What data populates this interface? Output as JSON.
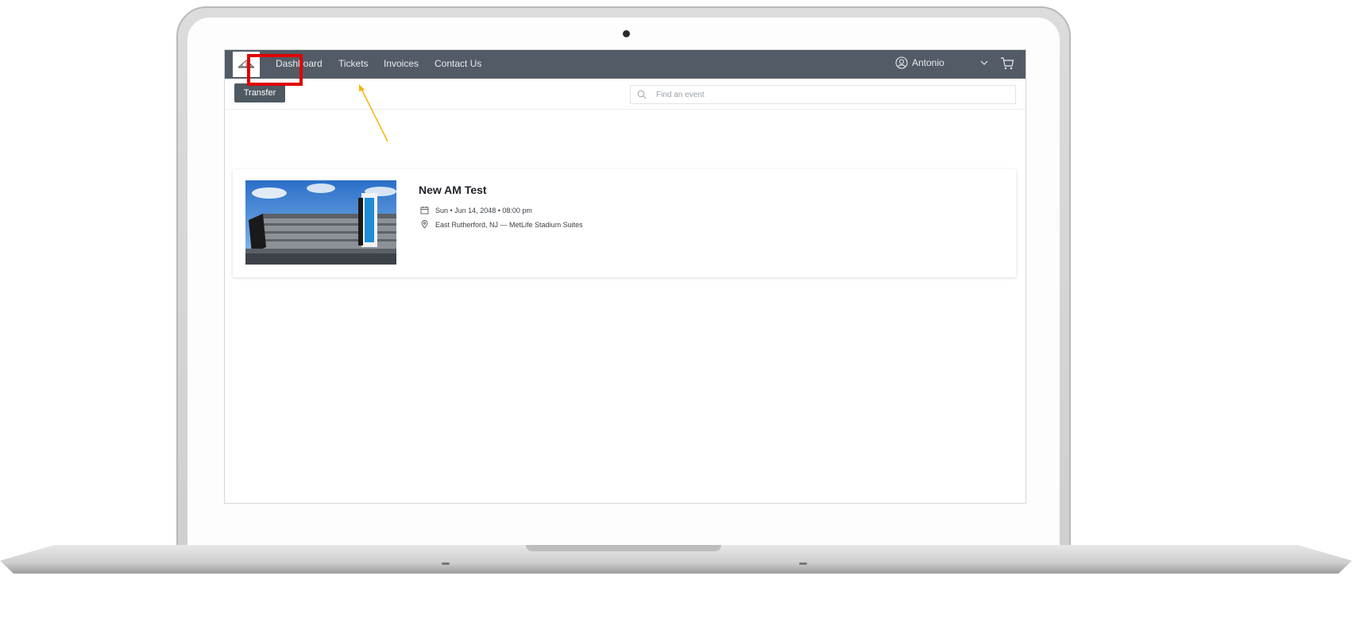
{
  "nav": {
    "items": [
      "Dashboard",
      "Tickets",
      "Invoices",
      "Contact Us"
    ],
    "user_name": "Antonio"
  },
  "toolbar": {
    "transfer_label": "Transfer",
    "search_placeholder": "Find an event"
  },
  "event": {
    "title": "New AM Test",
    "datetime": "Sun • Jun 14, 2048 • 08:00 pm",
    "location": "East Rutherford, NJ — MetLife Stadium Suites"
  },
  "colors": {
    "navbar": "#535c66",
    "button": "#4f5962",
    "highlight": "#e00000",
    "arrow": "#f5b400"
  },
  "icons": [
    "logo-icon",
    "user-circle-icon",
    "chevron-down-icon",
    "cart-icon",
    "search-icon",
    "calendar-icon",
    "location-pin-icon"
  ]
}
